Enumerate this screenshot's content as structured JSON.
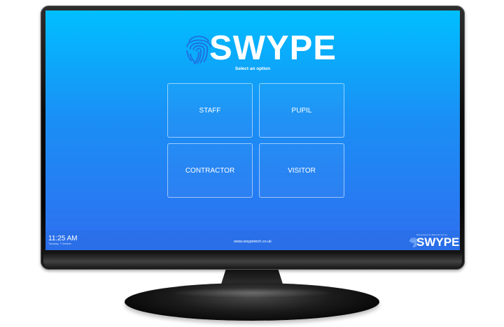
{
  "app": {
    "logo_text": "SWYPE",
    "subtitle": "Select an option"
  },
  "options": [
    {
      "label": "STAFF"
    },
    {
      "label": "PUPIL"
    },
    {
      "label": "CONTRACTOR"
    },
    {
      "label": "VISITOR"
    }
  ],
  "footer": {
    "time": "11:25 AM",
    "date": "Tuesday, 7 October",
    "website": "www.swypetech.co.uk",
    "brand_tagline": "Developed & Maintained by",
    "brand_name": "SWYPE"
  },
  "colors": {
    "screen_top": "#00bfff",
    "screen_bottom": "#2f6ff0",
    "fingerprint": "#1e6fe0",
    "text": "#ffffff"
  },
  "icons": {
    "logo": "fingerprint-icon",
    "brand": "fingerprint-icon"
  }
}
